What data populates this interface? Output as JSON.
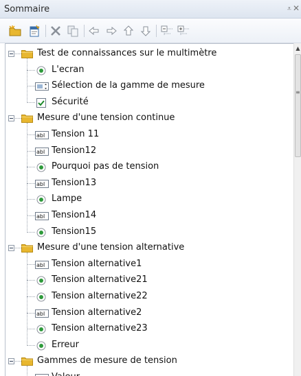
{
  "panel": {
    "title": "Sommaire",
    "pin_glyph": "⩡",
    "close_glyph": "✕"
  },
  "toolbar": {
    "buttons": [
      {
        "icon": "new-folder-icon"
      },
      {
        "icon": "new-page-icon"
      },
      {
        "icon": "delete-icon"
      },
      {
        "icon": "copy-icon"
      },
      {
        "icon": "arrow-left-icon"
      },
      {
        "icon": "arrow-right-icon"
      },
      {
        "icon": "arrow-up-icon"
      },
      {
        "icon": "arrow-down-icon"
      },
      {
        "icon": "collapse-all-icon"
      },
      {
        "icon": "expand-all-icon"
      }
    ]
  },
  "tree": {
    "groups": [
      {
        "label": "Test de connaissances sur le multimètre",
        "items": [
          {
            "label": "L'ecran",
            "icon": "radio-icon"
          },
          {
            "label": "Sélection de la gamme de mesure",
            "icon": "dropdown-list-icon"
          },
          {
            "label": "Sécurité",
            "icon": "checkbox-icon"
          }
        ]
      },
      {
        "label": "Mesure d'une tension continue",
        "items": [
          {
            "label": "Tension 11",
            "icon": "text-field-icon"
          },
          {
            "label": "Tension12",
            "icon": "text-field-icon"
          },
          {
            "label": "Pourquoi pas de tension",
            "icon": "radio-icon"
          },
          {
            "label": "Tension13",
            "icon": "text-field-icon"
          },
          {
            "label": "Lampe",
            "icon": "radio-icon"
          },
          {
            "label": "Tension14",
            "icon": "text-field-icon"
          },
          {
            "label": "Tension15",
            "icon": "radio-icon"
          }
        ]
      },
      {
        "label": "Mesure d'une tension alternative",
        "items": [
          {
            "label": "Tension alternative1",
            "icon": "text-field-icon"
          },
          {
            "label": "Tension alternative21",
            "icon": "radio-icon"
          },
          {
            "label": "Tension alternative22",
            "icon": "radio-icon"
          },
          {
            "label": "Tension alternative2",
            "icon": "text-field-icon"
          },
          {
            "label": "Tension alternative23",
            "icon": "radio-icon"
          },
          {
            "label": "Erreur",
            "icon": "radio-icon"
          }
        ]
      },
      {
        "label": "Gammes de mesure de tension",
        "items": [
          {
            "label": "Valeur",
            "icon": "text-field-icon"
          }
        ]
      }
    ]
  },
  "colors": {
    "folder": "#e8b730",
    "radio": "#2e9a3b",
    "check": "#1d8a2a",
    "title_bg": "#e4eaf3"
  }
}
